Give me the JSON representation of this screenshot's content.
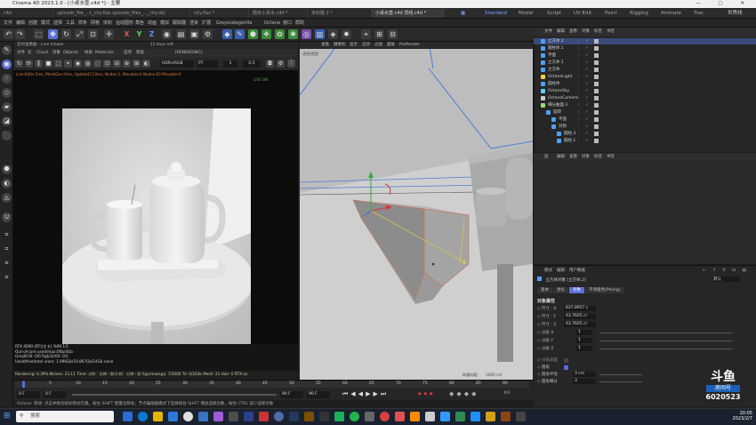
{
  "window": {
    "title": "Cinema 4D 2023.1.0 - [小桌水壶.c4d *] - 主要"
  },
  "file_tabs": [
    "c4d",
    "uploads_file_...t_city.flax *",
    "uploads_files_..._city.obj",
    "city.flax *",
    "题目小桌水.c4d *",
    "未标题 2 *",
    "小桌水壶.c4d 顶线.c4d *"
  ],
  "layouts": [
    "Standard",
    "Model",
    "Script",
    "UV Edit",
    "Paint",
    "Rigging",
    "Animate",
    "Trac"
  ],
  "layout_active": "Standard",
  "workspace_label": "世界线",
  "menus": [
    "文件",
    "编辑",
    "创建",
    "模式",
    "选择",
    "工具",
    "样条",
    "网格",
    "体积",
    "运动图形",
    "角色",
    "动画",
    "模拟",
    "跟踪器",
    "渲染",
    "扩展",
    "Greyscalegorilla",
    "Octane",
    "窗口",
    "帮助"
  ],
  "toolbar": {
    "x": "X",
    "y": "Y",
    "z": "Z"
  },
  "live_viewer": {
    "title": "实时查看器 - Live Viewer",
    "title_right": "33 days left",
    "menu": [
      "文件",
      "云",
      "Cloud",
      "对象",
      "Objects",
      "材质",
      "Materials",
      "选项",
      "帮助",
      "[RENDERING]"
    ],
    "mode": "HDR/sRGB",
    "preset": "PT",
    "field1": "1",
    "field2": "0.5",
    "status": "Live:Edits:2ms, MeshGen:0ms, Update[C]:0ms, Nodes:1, Movable:0 Nodes:83 Movable:0",
    "status_right": "LIVE ON",
    "info": [
      "RTX 4090 (RT)(主卡)     %99     1/1",
      "Out-of-core used/max:0Kb/4Gb",
      "Grey8/16: 0/0          Rgb32/64: 0/1",
      "Used/free/total vram: 1.996Gb/19.867Gb/24Gb   none"
    ],
    "render_bar": "Rendering: 0.39%   Ms/sec: 23.11   Time: 小时 : 分钟 : 秒/小时 : 分钟 : 秒   Spp/maxspp: 7/2000   Tri: 0/263k   Mesh: 21   Hair: 0   RTX:on"
  },
  "viewport": {
    "menu": [
      "查看",
      "摄像机",
      "显示",
      "选项",
      "过滤",
      "面板",
      "ProRender"
    ],
    "label": "透视视图",
    "footer_left": "网格间距",
    "footer_right": "1000 cm"
  },
  "timeline": {
    "ticks": [
      "0",
      "5",
      "10",
      "15",
      "20",
      "25",
      "30",
      "35",
      "40",
      "45",
      "50",
      "55",
      "60",
      "65",
      "70",
      "75",
      "80",
      "85",
      "90"
    ],
    "start": "0 F",
    "current": "0 F",
    "end": "90 F",
    "end2": "90 F",
    "frame_right": "0 F"
  },
  "object_manager": {
    "menu": [
      "文件",
      "编辑",
      "查看",
      "对象",
      "标签",
      "书签"
    ],
    "rows": [
      {
        "name": "立方体.2",
        "color": "#4fa0ff",
        "indent": 0,
        "selected": true
      },
      {
        "name": "圆柱体.1",
        "color": "#4fa0ff",
        "indent": 0
      },
      {
        "name": "平面",
        "color": "#4fa0ff",
        "indent": 0
      },
      {
        "name": "立方体.1",
        "color": "#4fa0ff",
        "indent": 0
      },
      {
        "name": "立方体",
        "color": "#4fa0ff",
        "indent": 0
      },
      {
        "name": "OctaneLight",
        "color": "#ffcc44",
        "indent": 0
      },
      {
        "name": "圆柱体",
        "color": "#4fa0ff",
        "indent": 0
      },
      {
        "name": "OctaneSky",
        "color": "#66ccff",
        "indent": 0
      },
      {
        "name": "OctaneCamera",
        "color": "#cccccc",
        "indent": 0
      },
      {
        "name": "细分曲面.3",
        "color": "#9fdf6f",
        "indent": 0
      },
      {
        "name": "旋转",
        "color": "#4fa0ff",
        "indent": 1
      },
      {
        "name": "平面",
        "color": "#4fa0ff",
        "indent": 2
      },
      {
        "name": "对称",
        "color": "#4fa0ff",
        "indent": 2
      },
      {
        "name": "圆柱.3",
        "color": "#4fa0ff",
        "indent": 3
      },
      {
        "name": "圆柱.1",
        "color": "#4fa0ff",
        "indent": 3
      }
    ]
  },
  "layers": {
    "menu": [
      "层",
      "编辑",
      "查看",
      "对象",
      "标签",
      "书签"
    ]
  },
  "attributes": {
    "menu": [
      "模式",
      "编辑",
      "用户数据"
    ],
    "object": "立方体对象 [立方体.2]",
    "mode": "默认",
    "tabs": [
      "基本",
      "坐标",
      "对象",
      "平滑着色(Phong)"
    ],
    "active_tab": "对象",
    "section": "对象属性",
    "rows": [
      {
        "label": "尺寸 . X",
        "value": "837.8957 c"
      },
      {
        "label": "尺寸 . Y",
        "value": "43.7605 cr"
      },
      {
        "label": "尺寸 . Z",
        "value": "43.7605 cr"
      },
      {
        "label": "分段 X",
        "value": "1"
      },
      {
        "label": "分段 Y",
        "value": "1"
      },
      {
        "label": "分段 Z",
        "value": "1"
      }
    ],
    "sep_label": "分离表面",
    "fillet_label": "圆角",
    "fillet_radius_label": "圆角半径",
    "fillet_radius": "3 cm",
    "fillet_seg_label": "圆角细分",
    "fillet_seg": "3"
  },
  "bottom_status": "Octane:    移动: 点击并拖动鼠标移动元素。按住 SHIFT 键量化移动；节点编辑器模式下选择按住 SHIFT 增加选择对象，按住 CTRL 减少选择对象",
  "watermark": {
    "brand": "斗鱼",
    "room_label": "房间号",
    "room": "6020523"
  },
  "taskbar": {
    "search": "搜索",
    "time": "20:05",
    "date": "2023/2/7"
  }
}
